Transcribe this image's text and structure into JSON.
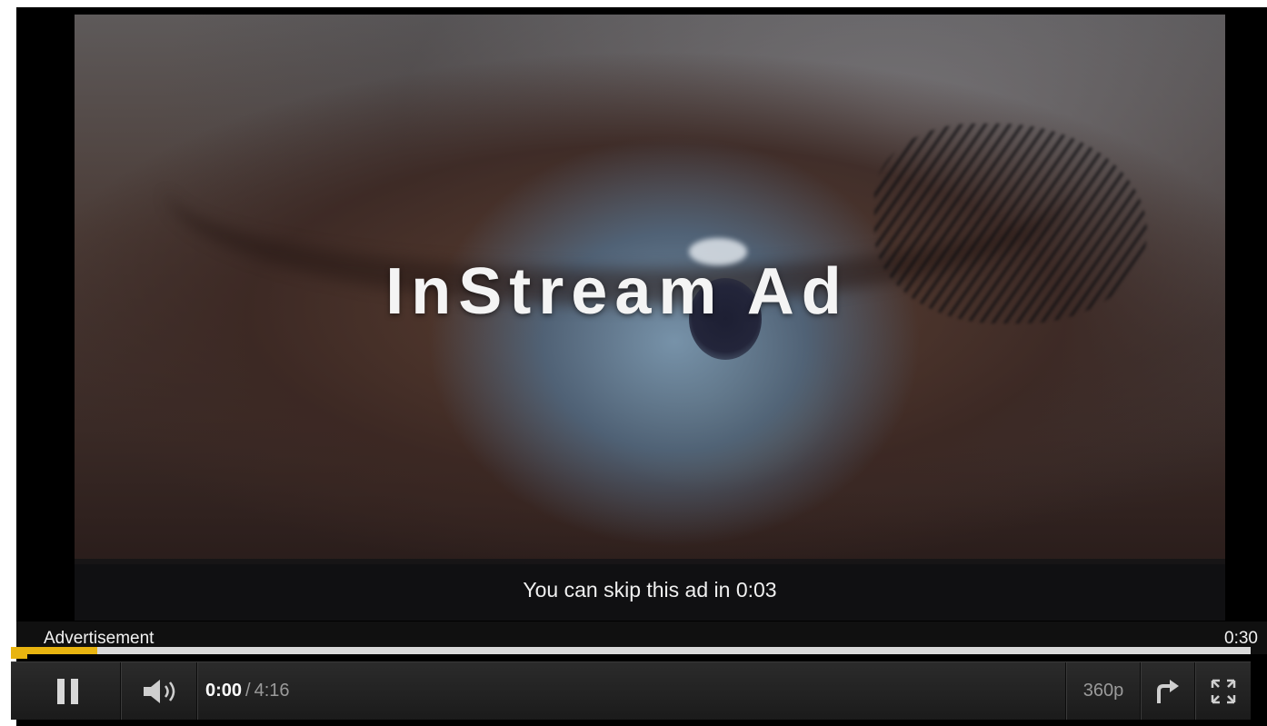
{
  "video": {
    "title_overlay": "InStream Ad"
  },
  "ad": {
    "skip_message": "You can skip this ad in 0:03",
    "label": "Advertisement",
    "duration": "0:30",
    "progress_fraction": 0.07
  },
  "controls": {
    "current_time": "0:00",
    "separator": "/",
    "total_time": "4:16",
    "quality": "360p",
    "icons": {
      "pause": "pause-icon",
      "volume": "volume-icon",
      "share": "share-icon",
      "fullscreen": "fullscreen-icon"
    }
  },
  "colors": {
    "progress_accent": "#e8b410",
    "bar_background": "#1b1b1b"
  }
}
